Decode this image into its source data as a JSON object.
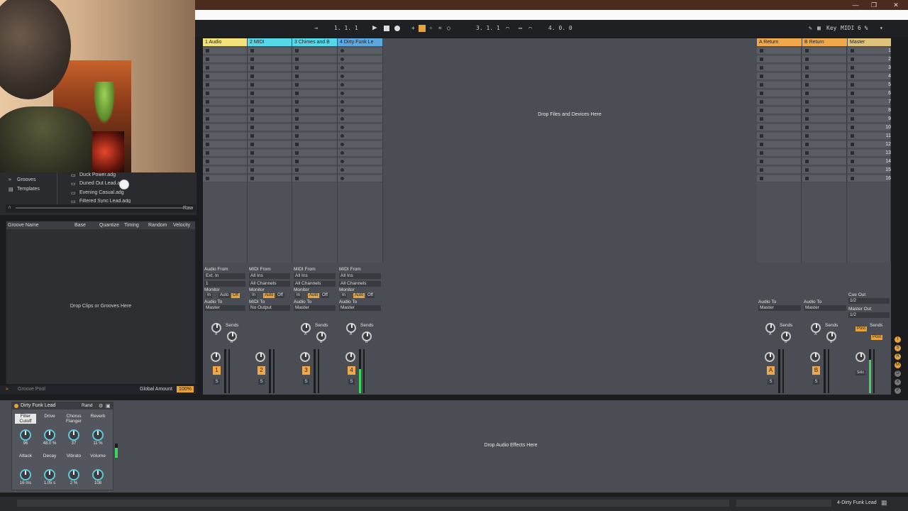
{
  "window": {
    "controls": [
      "—",
      "❐",
      "✕"
    ]
  },
  "transport": {
    "arrangement_position": "1.  1.  1",
    "loop_start": "3.  1.  1",
    "loop_length": "4.  0.  0",
    "key_label": "Key",
    "midi_label": "MIDI",
    "cpu": "6 %"
  },
  "browser": {
    "places": [
      {
        "label": "Grooves",
        "icon": "grooves-icon"
      },
      {
        "label": "Templates",
        "icon": "templates-icon"
      }
    ],
    "files": [
      "Duck Power.adg",
      "Duned Out Lead.adg",
      "Evening Casual.adg",
      "Filtered Sync Lead.adg"
    ],
    "raw_label": "Raw"
  },
  "groove_pool": {
    "columns": [
      "Groove Name",
      "Base",
      "Quantize",
      "Timing",
      "Random",
      "Velocity"
    ],
    "empty_hint": "Drop Clips or Grooves Here",
    "title": "Groove Pool",
    "global_amount_label": "Global Amount",
    "global_amount_value": "100%"
  },
  "session": {
    "drop_hint": "Drop Files and Devices Here",
    "tracks": [
      {
        "name": "1 Audio",
        "color": "#f2e27b",
        "io_from_label": "Audio From",
        "io_from": "Ext. In",
        "channel": "1",
        "monitor_label": "Monitor",
        "to_label": "Audio To",
        "to": "Master",
        "number": "1"
      },
      {
        "name": "2 MIDI",
        "color": "#55d8e8",
        "io_from_label": "MIDI From",
        "io_from": "All Ins",
        "channel": "All Channels",
        "monitor_label": "Monitor",
        "to_label": "MIDI To",
        "to": "No Output",
        "number": "2"
      },
      {
        "name": "3 Chimes and B",
        "color": "#55d8e8",
        "io_from_label": "MIDI From",
        "io_from": "All Ins",
        "channel": "All Channels",
        "monitor_label": "Monitor",
        "to_label": "Audio To",
        "to": "Master",
        "number": "3"
      },
      {
        "name": "4 Dirty Funk Le",
        "color": "#5ca8e0",
        "io_from_label": "MIDI From",
        "io_from": "All Ins",
        "channel": "All Channels",
        "monitor_label": "Monitor",
        "to_label": "Audio To",
        "to": "Master",
        "number": "4"
      }
    ],
    "monitor_options": [
      "In",
      "Auto",
      "Off"
    ],
    "sends_label": "Sends",
    "send_a": "A",
    "send_b": "B",
    "solo": "S",
    "returns": [
      {
        "name": "A Return",
        "color": "#f0a84a",
        "to_label": "Audio To",
        "to": "Master",
        "letter": "A"
      },
      {
        "name": "B Return",
        "color": "#f0a84a",
        "to_label": "Audio To",
        "to": "Master",
        "letter": "B"
      }
    ],
    "master": {
      "name": "Master",
      "color": "#e0c27a",
      "cue_label": "Cue Out",
      "cue": "1/2",
      "out_label": "Master Out",
      "out": "1/2",
      "post": "Post",
      "solo": "Solo"
    },
    "scenes": [
      "1",
      "2",
      "3",
      "4",
      "5",
      "6",
      "7",
      "8",
      "9",
      "10",
      "11",
      "12",
      "13",
      "14",
      "15",
      "16"
    ]
  },
  "device": {
    "rack_name": "Dirty Funk Lead",
    "rand_label": "Rand",
    "macros": [
      {
        "label": "Filter Cutoff",
        "value": "96"
      },
      {
        "label": "Drive",
        "value": "48.0 %"
      },
      {
        "label": "Chorus Flanger",
        "value": "37"
      },
      {
        "label": "Reverb",
        "value": "11 %"
      },
      {
        "label": "Attack",
        "value": "16 ms"
      },
      {
        "label": "Decay",
        "value": "1.05 s"
      },
      {
        "label": "Vibrato",
        "value": "2 %"
      },
      {
        "label": "Volume",
        "value": "108"
      }
    ],
    "drop_hint": "Drop Audio Effects Here"
  },
  "statusbar": {
    "selected_track": "4-Dirty Funk Lead"
  }
}
